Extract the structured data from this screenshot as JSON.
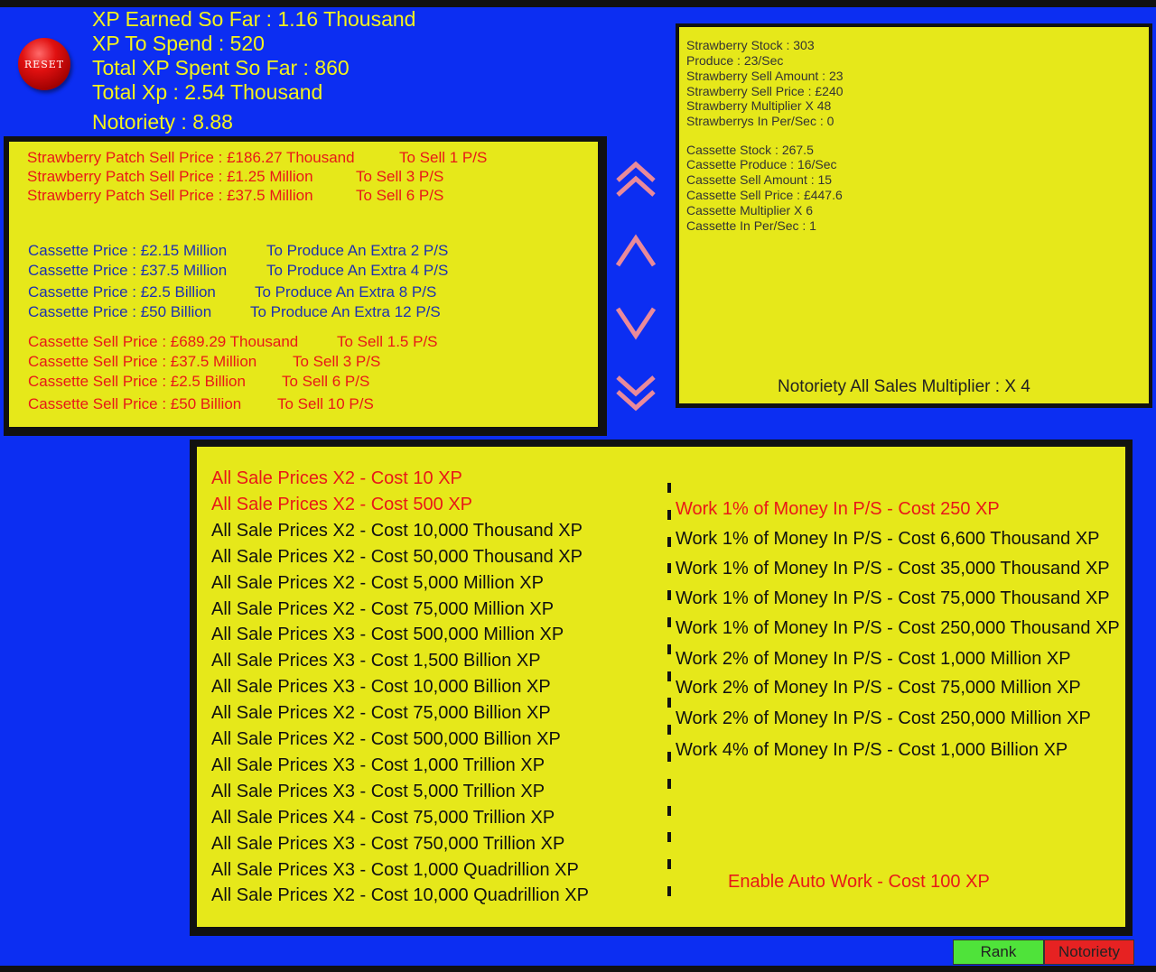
{
  "header": {
    "reset_label": "RESET",
    "xp_earned": "XP Earned So Far : 1.16 Thousand",
    "xp_to_spend": "XP To Spend : 520",
    "xp_spent": "Total XP Spent So Far : 860",
    "total_xp": "Total Xp : 2.54 Thousand",
    "notoriety": "Notoriety : 8.88"
  },
  "left_panel": {
    "patch_rows": [
      {
        "price": "Strawberry Patch Sell Price : £186.27 Thousand",
        "rate": "To Sell  1 P/S"
      },
      {
        "price": "Strawberry Patch Sell Price : £1.25 Million",
        "rate": "To Sell  3 P/S"
      },
      {
        "price": "Strawberry Patch Sell Price : £37.5 Million",
        "rate": "To Sell  6 P/S"
      }
    ],
    "cassette_rows": [
      {
        "price": "Cassette Price : £2.15 Million",
        "rate": "To Produce An Extra 2 P/S"
      },
      {
        "price": "Cassette Price : £37.5 Million",
        "rate": "To Produce An Extra 4 P/S"
      },
      {
        "price": "Cassette Price : £2.5 Billion",
        "rate": "To Produce An Extra 8 P/S"
      },
      {
        "price": "Cassette Price : £50 Billion",
        "rate": "To Produce An Extra 12 P/S"
      }
    ],
    "cassette_sell_rows": [
      {
        "price": "Cassette Sell Price : £689.29 Thousand",
        "rate": "To Sell 1.5 P/S"
      },
      {
        "price": "Cassette Sell Price : £37.5 Million",
        "rate": "To Sell 3 P/S"
      },
      {
        "price": "Cassette Sell Price : £2.5 Billion",
        "rate": "To Sell 6 P/S"
      },
      {
        "price": "Cassette Sell Price : £50 Billion",
        "rate": "To Sell 10 P/S"
      }
    ]
  },
  "right_panel": {
    "strawberry": [
      "Strawberry Stock : 303",
      "Produce : 23/Sec",
      "Strawberry Sell Amount : 23",
      "Strawberry Sell Price : £240",
      "Strawberry Multiplier X 48",
      "Strawberrys In Per/Sec : 0"
    ],
    "cassette": [
      "Cassette Stock : 267.5",
      "Cassette Produce : 16/Sec",
      "Cassette Sell Amount : 15",
      "Cassette Sell Price : £447.6",
      "Cassette Multiplier X 6",
      "Cassette In Per/Sec : 1"
    ],
    "multiplier": "Notoriety All Sales Multiplier : X 4"
  },
  "upgrades": [
    {
      "text": "All Sale Prices X2 - Cost 10 XP",
      "affordable": true
    },
    {
      "text": "All Sale Prices X2 - Cost 500 XP",
      "affordable": true
    },
    {
      "text": "All Sale Prices X2 - Cost 10,000 Thousand XP",
      "affordable": false
    },
    {
      "text": "All Sale Prices X2 - Cost 50,000 Thousand XP",
      "affordable": false
    },
    {
      "text": "All Sale Prices X2 - Cost 5,000 Million XP",
      "affordable": false
    },
    {
      "text": "All Sale Prices X2 - Cost 75,000 Million XP",
      "affordable": false
    },
    {
      "text": "All Sale Prices X3 - Cost 500,000 Million XP",
      "affordable": false
    },
    {
      "text": "All Sale Prices X3 - Cost 1,500 Billion XP",
      "affordable": false
    },
    {
      "text": "All Sale Prices X3 - Cost 10,000 Billion XP",
      "affordable": false
    },
    {
      "text": "All Sale Prices X2 - Cost 75,000 Billion XP",
      "affordable": false
    },
    {
      "text": "All Sale Prices X2 - Cost 500,000 Billion XP",
      "affordable": false
    },
    {
      "text": "All Sale Prices X3 - Cost 1,000 Trillion XP",
      "affordable": false
    },
    {
      "text": "All Sale Prices X3 - Cost 5,000 Trillion XP",
      "affordable": false
    },
    {
      "text": "All Sale Prices X4 - Cost 75,000 Trillion XP",
      "affordable": false
    },
    {
      "text": "All Sale Prices X3 - Cost 750,000 Trillion XP",
      "affordable": false
    },
    {
      "text": "All Sale Prices X3 - Cost 1,000 Quadrillion XP",
      "affordable": false
    },
    {
      "text": "All Sale Prices X2 - Cost 10,000 Quadrillion XP",
      "affordable": false
    }
  ],
  "work_upgrades": [
    {
      "text": "Work 1% of Money In P/S - Cost 250 XP",
      "affordable": true
    },
    {
      "text": "Work 1% of Money In P/S - Cost 6,600 Thousand XP",
      "affordable": false
    },
    {
      "text": "Work 1% of Money In P/S - Cost 35,000 Thousand XP",
      "affordable": false
    },
    {
      "text": "Work 1% of Money In P/S - Cost 75,000 Thousand XP",
      "affordable": false
    },
    {
      "text": "Work 1% of Money In P/S - Cost 250,000 Thousand XP",
      "affordable": false
    },
    {
      "text": "Work 2% of Money In P/S - Cost 1,000 Million XP",
      "affordable": false
    },
    {
      "text": "Work 2% of Money In P/S - Cost 75,000 Million XP",
      "affordable": false
    },
    {
      "text": "Work 2% of Money In P/S - Cost 250,000 Million XP",
      "affordable": false
    },
    {
      "text": "Work 4% of Money In P/S - Cost 1,000 Billion XP",
      "affordable": false
    }
  ],
  "auto_work": "Enable Auto Work - Cost 100 XP",
  "tabs": {
    "rank": "Rank",
    "notoriety": "Notoriety"
  },
  "colors": {
    "background": "#0c2ef2",
    "panel": "#e6e81a",
    "highlight_text": "#f4f21c",
    "affordable": "#e81818",
    "cassette_text": "#1d31b0",
    "arrow": "#e98a9a",
    "rank_tab": "#4fe33a",
    "notoriety_tab": "#e62222"
  },
  "icons": [
    "double-chevron-up-icon",
    "chevron-up-icon",
    "chevron-down-icon",
    "double-chevron-down-icon"
  ]
}
